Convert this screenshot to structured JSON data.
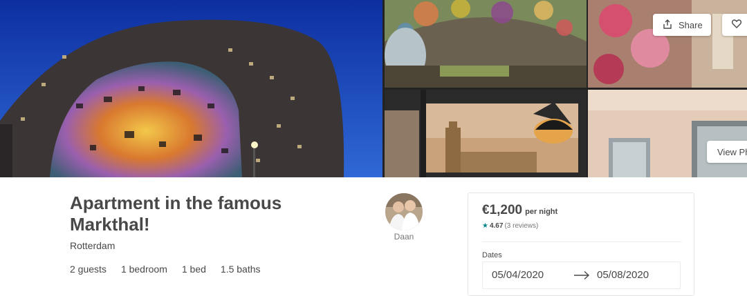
{
  "gallery": {
    "share_label": "Share",
    "view_photos_label": "View Photos",
    "icons": {
      "share": "share-icon",
      "save": "heart-icon"
    }
  },
  "listing": {
    "title": "Apartment in the famous Markthal!",
    "location": "Rotterdam",
    "summary": [
      "2 guests",
      "1 bedroom",
      "1 bed",
      "1.5 baths"
    ]
  },
  "host": {
    "name": "Daan"
  },
  "booking": {
    "price": "€1,200",
    "per_night": "per night",
    "rating_star": "★",
    "rating": "4.67",
    "reviews": "(3 reviews)",
    "dates_label": "Dates",
    "check_in": "05/04/2020",
    "check_out": "05/08/2020"
  },
  "colors": {
    "accent": "#008489",
    "text": "#484848",
    "muted": "#767676"
  }
}
